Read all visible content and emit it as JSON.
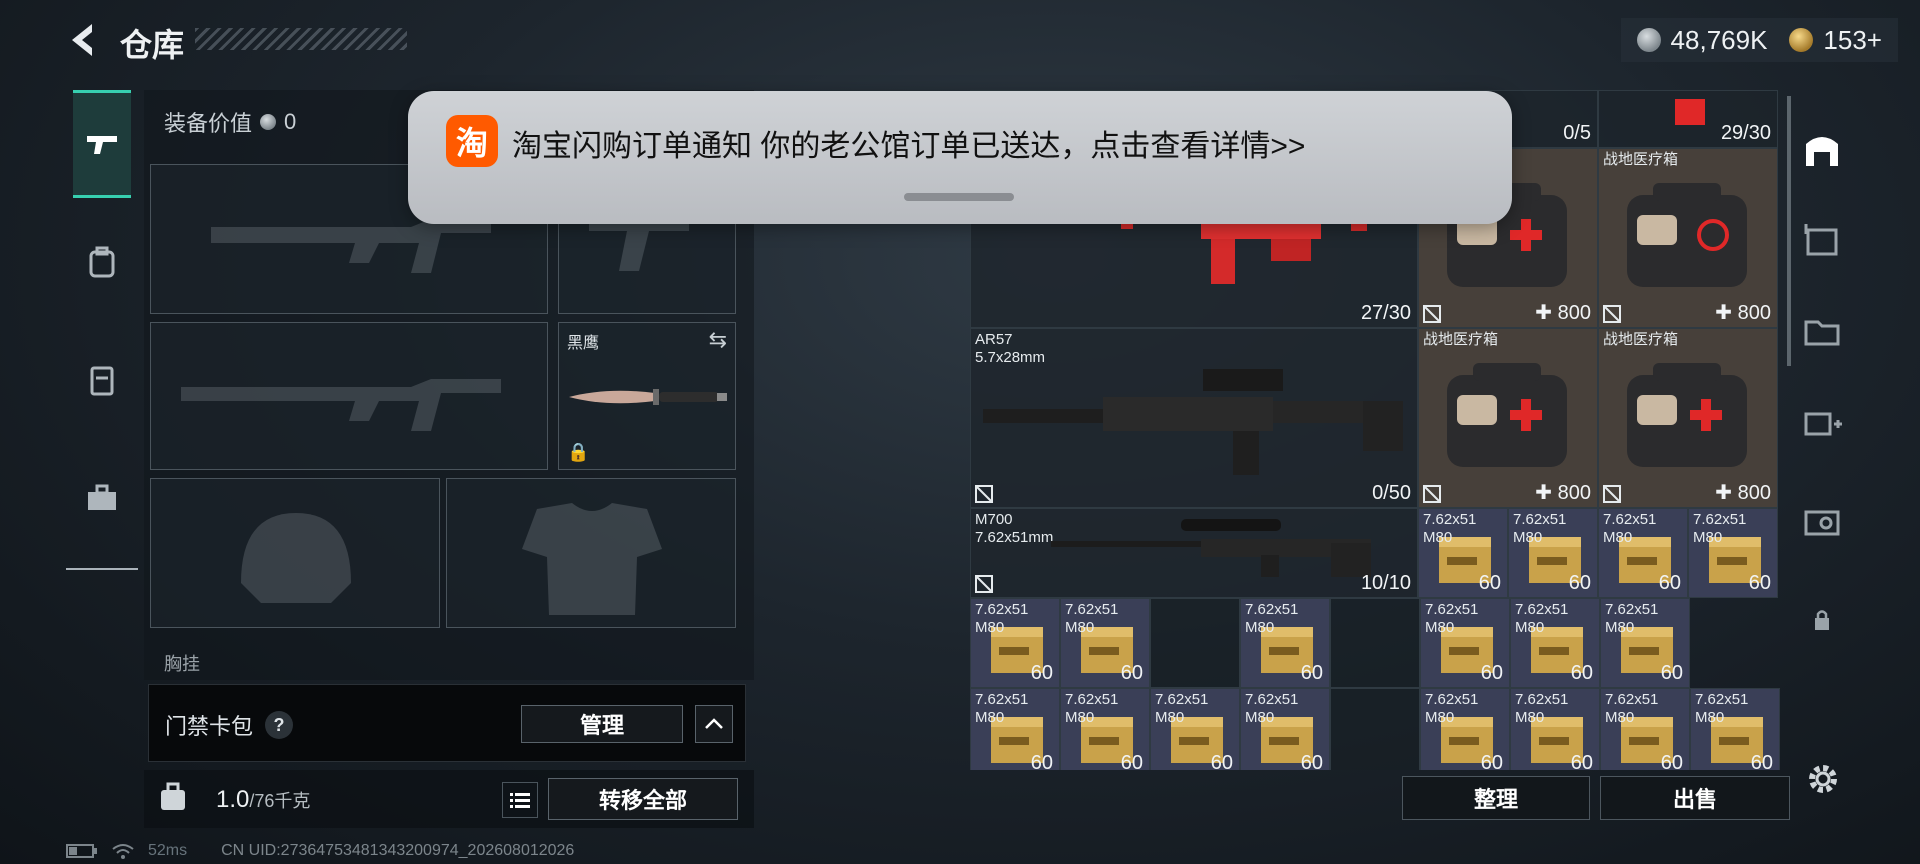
{
  "header": {
    "title": "仓库"
  },
  "currency": {
    "silver": "48,769K",
    "gold": "153+"
  },
  "left_tabs": [
    {
      "icon": "gun-icon",
      "active": true
    },
    {
      "icon": "backpack-icon"
    },
    {
      "icon": "vest-icon"
    },
    {
      "icon": "briefcase-icon"
    }
  ],
  "equipment": {
    "value_label": "装备价值",
    "value": "0",
    "melee_label": "黑鹰",
    "chest_label": "胸挂"
  },
  "keycard": {
    "label": "门禁卡包",
    "help": "?",
    "manage": "管理"
  },
  "weight": {
    "value": "1.0",
    "capacity": "/76千克",
    "transfer_all": "转移全部"
  },
  "storage": {
    "top_counts": [
      "0/5",
      "29/30"
    ],
    "weapon1_count": "27/30",
    "ar57": {
      "name": "AR57",
      "caliber": "5.7x28mm",
      "count": "0/50"
    },
    "m700": {
      "name": "M700",
      "caliber": "7.62x51mm",
      "count": "10/10"
    },
    "med_label": "战地医疗箱",
    "med_value": "800",
    "ammo_name": "7.62x51\nM80",
    "ammo_count": "60"
  },
  "actions": {
    "sort": "整理",
    "sell": "出售"
  },
  "status": {
    "ping": "52ms",
    "uid": "CN UID:27364753481343200974_202608012026"
  },
  "notification": {
    "app_icon_text": "淘",
    "text": "淘宝闪购订单通知 你的老公馆订单已送达，点击查看详情>>"
  }
}
